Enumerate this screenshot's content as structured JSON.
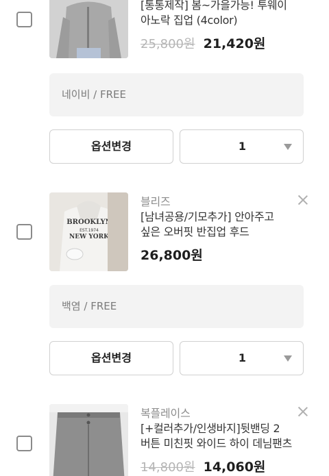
{
  "items": [
    {
      "title_lines": [
        "[통통제작] 봄~가을가능! 투웨이",
        "아노락 집업 (4color)"
      ],
      "original_price": "25,800원",
      "sale_price": "21,420원",
      "option": "네이비 / FREE",
      "change_button": "옵션변경",
      "quantity": "1"
    },
    {
      "brand": "블리즈",
      "title_lines": [
        "[남녀공용/기모추가] 안아주고",
        "싶은 오버핏 반집업 후드"
      ],
      "sale_price": "26,800원",
      "option": "백염 / FREE",
      "change_button": "옵션변경",
      "quantity": "1",
      "thumb_print": [
        "BROOKLYN",
        "EST.1974",
        "NEW YORK"
      ]
    },
    {
      "brand": "복플레이스",
      "title_lines": [
        "[+컬러추가/인생바지]뒷밴딩 2",
        "버튼 미친핏 와이드 하이 데님팬츠"
      ],
      "original_price": "14,800원",
      "sale_price": "14,060원"
    }
  ],
  "icons": {
    "close": "close-icon",
    "dropdown": "chevron-down-icon",
    "checkbox": "checkbox-icon"
  },
  "colors": {
    "option_bg": "#f3f3f3",
    "strike_price": "#b5b5b5",
    "brand_text": "#8c8c8c"
  }
}
